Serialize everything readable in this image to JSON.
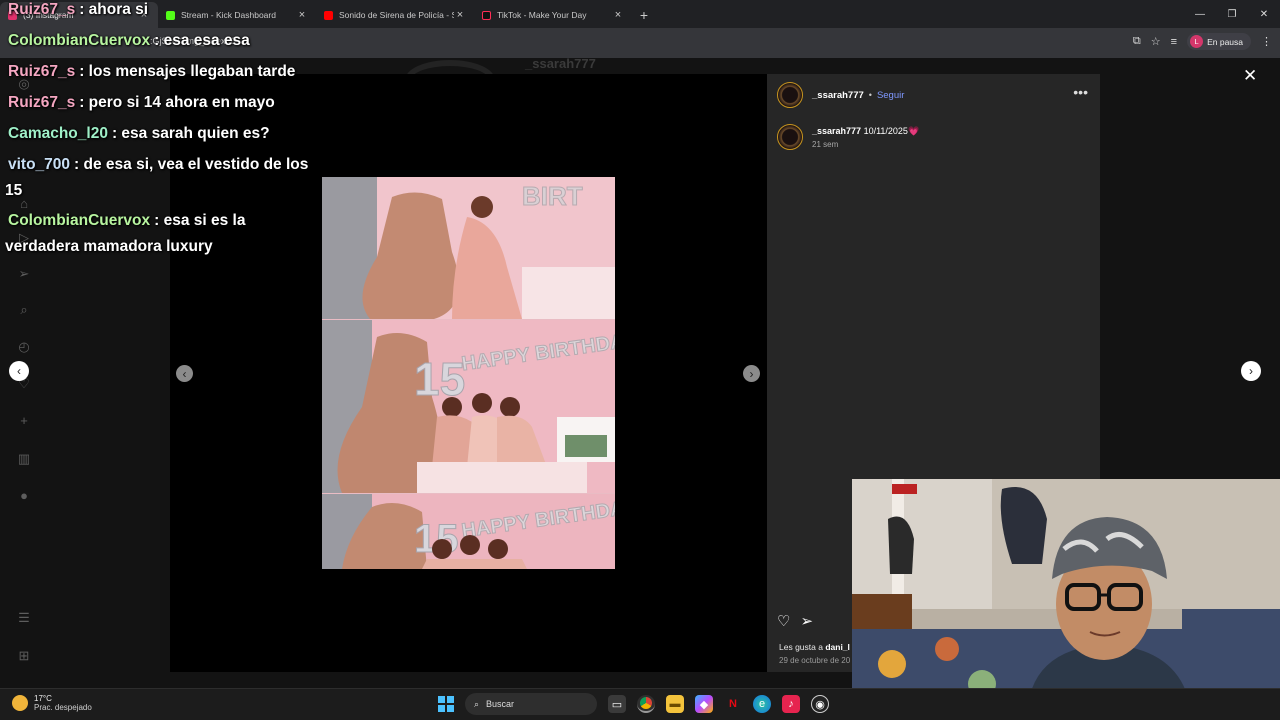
{
  "browser": {
    "tabs": [
      {
        "label": "(3) Instagram",
        "color": "#e1306c",
        "active": true
      },
      {
        "label": "Stream - Kick Dashboard",
        "color": "#53fc18",
        "active": false
      },
      {
        "label": "Sonido de Sirena de Policía - Su",
        "color": "#ff0000",
        "active": false
      },
      {
        "label": "TikTok - Make Your Day",
        "color": "#111111",
        "active": false
      }
    ],
    "url": ":GjSxu/?img_index=6",
    "profile_initial": "L",
    "profile_status": "En pausa"
  },
  "chat": [
    {
      "user": "Ruiz67_s",
      "color": "#f4a6c1",
      "text": ": ahora si"
    },
    {
      "user": "ColombianCuervox",
      "color": "#b8f5a0",
      "text": ": esa esa esa"
    },
    {
      "user": "Ruiz67_s",
      "color": "#f4a6c1",
      "text": ": los mensajes llegaban tarde"
    },
    {
      "user": "Ruiz67_s",
      "color": "#f4a6c1",
      "text": ": pero si 14 ahora en mayo"
    },
    {
      "user": "Camacho_l20",
      "color": "#9ff0c8",
      "text": ": esa sarah quien es?"
    },
    {
      "user": "vito_700",
      "color": "#c9e0f5",
      "text": ": de esa si, vea el vestido de los",
      "cont": "15"
    },
    {
      "user": "ColombianCuervox",
      "color": "#b8f5a0",
      "text": ": esa si es la",
      "cont": "verdadera mamadora luxury"
    }
  ],
  "background_profile": {
    "username": "_ssarah777"
  },
  "post": {
    "username": "_ssarah777",
    "follow_label": "Seguir",
    "caption_user": "_ssarah777",
    "caption_text": "10/11/2025",
    "caption_emoji": "💗",
    "age": "21 sem",
    "likes_prefix": "Les gusta a",
    "likes_user": "dani_l",
    "date": "29 de octubre de 20"
  },
  "photo_text": {
    "top": "BIRT",
    "mid": "HAPPY BIRTHDAY",
    "num": "15"
  },
  "taskbar": {
    "temperature": "17°C",
    "weather": "Prac. despejado",
    "search_placeholder": "Buscar"
  }
}
